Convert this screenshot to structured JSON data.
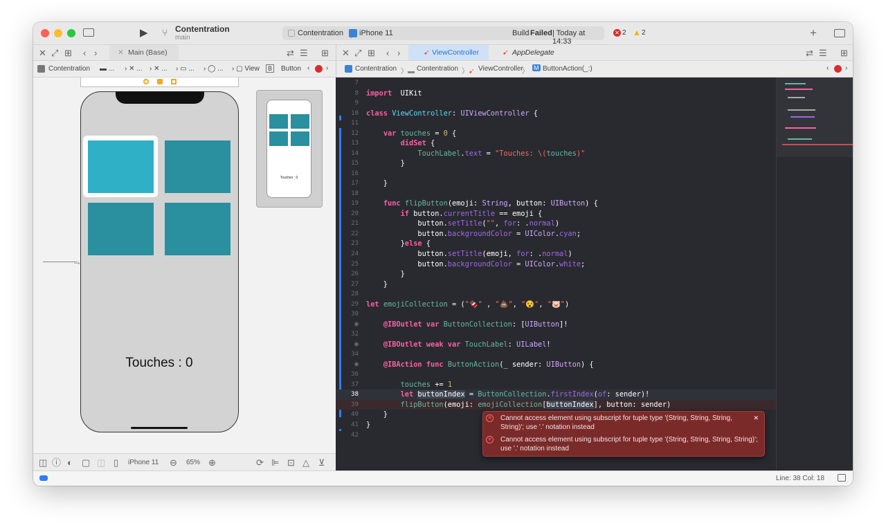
{
  "titlebar": {
    "project": "Contentration",
    "branch": "main",
    "scheme": "Contentration",
    "device": "iPhone 11",
    "build_prefix": "Build",
    "build_status": "Failed",
    "build_time": "| Today at 14:33",
    "errors": "2",
    "warnings": "2"
  },
  "left_tabs": {
    "active": "Main (Base)"
  },
  "left_crumbs": {
    "root": "Contentration",
    "e1": "...",
    "e2": "...",
    "e3": "...",
    "e4": "...",
    "e5": "...",
    "view": "View",
    "button_badge": "B",
    "button": "Button"
  },
  "right_tabs": [
    {
      "label": "ViewController"
    },
    {
      "label": "AppDelegate"
    }
  ],
  "right_crumbs": {
    "root": "Contentration",
    "folder": "Contentration",
    "file": "ViewController",
    "method_badge": "M",
    "method": "ButtonAction(_:)"
  },
  "canvas": {
    "touches_label": "Touches : 0",
    "preview_label": "Touches : 0",
    "square_color": "#2a8f9e",
    "selected_color": "#30b0c7"
  },
  "canvas_toolbar": {
    "device": "iPhone 11",
    "zoom": "65%"
  },
  "status": {
    "position": "Line: 38  Col: 18"
  },
  "code": [
    {
      "n": "7",
      "c": []
    },
    {
      "n": "8",
      "c": [
        [
          "k",
          "import"
        ],
        [
          "",
          "  UIKit"
        ]
      ]
    },
    {
      "n": "9",
      "c": []
    },
    {
      "n": "10",
      "c": [
        [
          "k",
          "class"
        ],
        [
          "",
          " "
        ],
        [
          "pt",
          "ViewController"
        ],
        [
          "",
          ": "
        ],
        [
          "t",
          "UIViewController"
        ],
        [
          "",
          " {"
        ]
      ]
    },
    {
      "n": "11",
      "c": []
    },
    {
      "n": "12",
      "c": [
        [
          "",
          "    "
        ],
        [
          "k",
          "var"
        ],
        [
          "",
          " "
        ],
        [
          "pv",
          "touches"
        ],
        [
          "",
          " = "
        ],
        [
          "n",
          "0"
        ],
        [
          "",
          " {"
        ]
      ]
    },
    {
      "n": "13",
      "c": [
        [
          "",
          "        "
        ],
        [
          "k",
          "didSet"
        ],
        [
          "",
          " {"
        ]
      ]
    },
    {
      "n": "14",
      "c": [
        [
          "",
          "            "
        ],
        [
          "pv",
          "TouchLabel"
        ],
        [
          "",
          "."
        ],
        [
          "f",
          "text"
        ],
        [
          "",
          " = "
        ],
        [
          "s",
          "\"Touches: \\("
        ],
        [
          "pv",
          "touches"
        ],
        [
          "s",
          ")\""
        ]
      ]
    },
    {
      "n": "15",
      "c": [
        [
          "",
          "        }"
        ]
      ]
    },
    {
      "n": "16",
      "c": []
    },
    {
      "n": "17",
      "c": [
        [
          "",
          "    }"
        ]
      ]
    },
    {
      "n": "18",
      "c": []
    },
    {
      "n": "19",
      "c": [
        [
          "",
          "    "
        ],
        [
          "k",
          "func"
        ],
        [
          "",
          " "
        ],
        [
          "pf",
          "flipButton"
        ],
        [
          "",
          "(emoji: "
        ],
        [
          "t",
          "String"
        ],
        [
          "",
          ", button: "
        ],
        [
          "t",
          "UIButton"
        ],
        [
          "",
          ") {"
        ]
      ]
    },
    {
      "n": "20",
      "c": [
        [
          "",
          "        "
        ],
        [
          "k",
          "if"
        ],
        [
          "",
          " button."
        ],
        [
          "f",
          "currentTitle"
        ],
        [
          "",
          " == emoji {"
        ]
      ]
    },
    {
      "n": "21",
      "c": [
        [
          "",
          "            button."
        ],
        [
          "f",
          "setTitle"
        ],
        [
          "",
          "("
        ],
        [
          "s",
          "\"\""
        ],
        [
          "",
          ", "
        ],
        [
          "f",
          "for"
        ],
        [
          "",
          ": ."
        ],
        [
          "f",
          "normal"
        ],
        [
          "",
          ")"
        ]
      ]
    },
    {
      "n": "22",
      "c": [
        [
          "",
          "            button."
        ],
        [
          "f",
          "backgroundColor"
        ],
        [
          "",
          " = "
        ],
        [
          "t",
          "UIColor"
        ],
        [
          "",
          "."
        ],
        [
          "f",
          "cyan"
        ],
        [
          "",
          ";"
        ]
      ]
    },
    {
      "n": "23",
      "c": [
        [
          "",
          "        }"
        ],
        [
          "k",
          "else"
        ],
        [
          "",
          " {"
        ]
      ]
    },
    {
      "n": "24",
      "c": [
        [
          "",
          "            button."
        ],
        [
          "f",
          "setTitle"
        ],
        [
          "",
          "(emoji, "
        ],
        [
          "f",
          "for"
        ],
        [
          "",
          ": ."
        ],
        [
          "f",
          "normal"
        ],
        [
          "",
          ")"
        ]
      ]
    },
    {
      "n": "25",
      "c": [
        [
          "",
          "            button."
        ],
        [
          "f",
          "backgroundColor"
        ],
        [
          "",
          " = "
        ],
        [
          "t",
          "UIColor"
        ],
        [
          "",
          "."
        ],
        [
          "f",
          "white"
        ],
        [
          "",
          ";"
        ]
      ]
    },
    {
      "n": "26",
      "c": [
        [
          "",
          "        }"
        ]
      ]
    },
    {
      "n": "27",
      "c": [
        [
          "",
          "    }"
        ]
      ]
    },
    {
      "n": "28",
      "c": []
    },
    {
      "n": "29",
      "c": [
        [
          "k",
          "let"
        ],
        [
          "",
          " "
        ],
        [
          "pv",
          "emojiCollection"
        ],
        [
          "",
          " = ("
        ],
        [
          "s",
          "\"🍫\""
        ],
        [
          "",
          " , "
        ],
        [
          "s",
          "\"💩\""
        ],
        [
          "",
          ", "
        ],
        [
          "s",
          "\"😵\""
        ],
        [
          "",
          ", "
        ],
        [
          "s",
          "\"🐷\""
        ],
        [
          "",
          ")"
        ]
      ]
    },
    {
      "n": "30",
      "c": []
    },
    {
      "n": "",
      "m": true,
      "c": [
        [
          "",
          "    "
        ],
        [
          "k",
          "@IBOutlet var"
        ],
        [
          "",
          " "
        ],
        [
          "pv",
          "ButtonCollection"
        ],
        [
          "",
          ": ["
        ],
        [
          "t",
          "UIButton"
        ],
        [
          "",
          "]!"
        ]
      ]
    },
    {
      "n": "32",
      "c": []
    },
    {
      "n": "",
      "m": true,
      "c": [
        [
          "",
          "    "
        ],
        [
          "k",
          "@IBOutlet weak var"
        ],
        [
          "",
          " "
        ],
        [
          "pv",
          "TouchLabel"
        ],
        [
          "",
          ": "
        ],
        [
          "t",
          "UILabel"
        ],
        [
          "",
          "!"
        ]
      ]
    },
    {
      "n": "34",
      "c": []
    },
    {
      "n": "",
      "m": true,
      "c": [
        [
          "",
          "    "
        ],
        [
          "k",
          "@IBAction func"
        ],
        [
          "",
          " "
        ],
        [
          "pf",
          "ButtonAction"
        ],
        [
          "",
          "(_ sender: "
        ],
        [
          "t",
          "UIButton"
        ],
        [
          "",
          ") {"
        ]
      ]
    },
    {
      "n": "36",
      "c": []
    },
    {
      "n": "37",
      "c": [
        [
          "",
          "        "
        ],
        [
          "pv",
          "touches"
        ],
        [
          "",
          " += "
        ],
        [
          "n",
          "1"
        ]
      ]
    },
    {
      "n": "38",
      "cur": true,
      "c": [
        [
          "",
          "        "
        ],
        [
          "k",
          "let"
        ],
        [
          "",
          " "
        ],
        [
          "hl",
          "buttonIndex"
        ],
        [
          "",
          " = "
        ],
        [
          "pv",
          "ButtonCollection"
        ],
        [
          "",
          "."
        ],
        [
          "f",
          "firstIndex"
        ],
        [
          "",
          "("
        ],
        [
          "f",
          "of"
        ],
        [
          "",
          ": sender)!"
        ]
      ]
    },
    {
      "n": "39",
      "errl": true,
      "c": [
        [
          "",
          "        "
        ],
        [
          "pf",
          "flipButton"
        ],
        [
          "",
          "(emoji: "
        ],
        [
          "pv",
          "emojiCollection"
        ],
        [
          "",
          "["
        ],
        [
          "hl",
          "buttonIndex"
        ],
        [
          "",
          "], button: sender)"
        ]
      ]
    },
    {
      "n": "40",
      "c": [
        [
          "",
          "    }"
        ]
      ]
    },
    {
      "n": "41",
      "c": [
        [
          "",
          "}"
        ]
      ]
    },
    {
      "n": "42",
      "c": []
    }
  ],
  "errors": [
    {
      "text": "Cannot access element using subscript for tuple type '(String, String, String, String)'; use '.' notation instead"
    },
    {
      "text": "Cannot access element using subscript for tuple type '(String, String, String, String)'; use '.' notation instead"
    }
  ]
}
